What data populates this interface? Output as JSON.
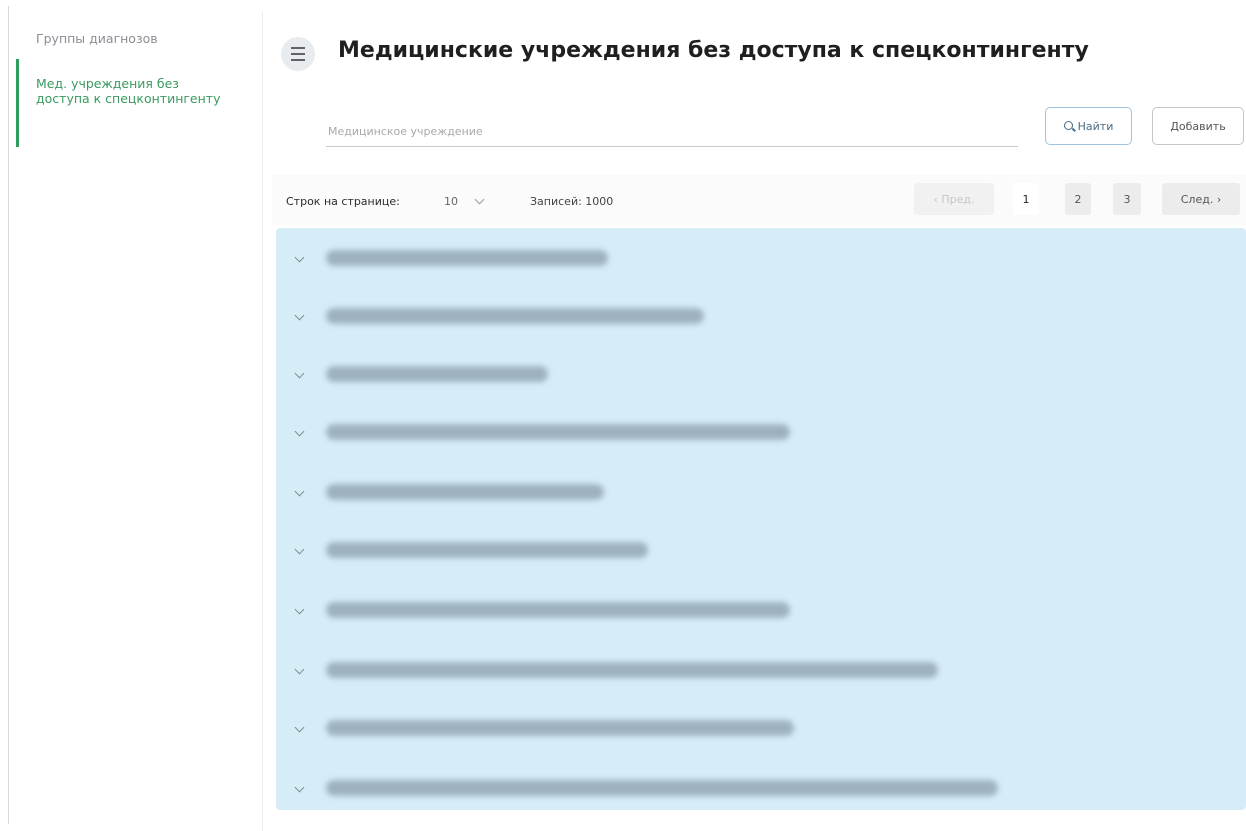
{
  "sidebar": {
    "items": [
      {
        "label": "Группы диагнозов"
      },
      {
        "label": "Мед. учреждения без доступа к спецконтингенту"
      }
    ]
  },
  "header": {
    "title": "Медицинские учреждения без доступа к спецконтингенту",
    "menu_icon": "hamburger-icon"
  },
  "search": {
    "placeholder": "Медицинское учреждение",
    "value": "",
    "find_label": "Найти",
    "add_label": "Добавить"
  },
  "pagination": {
    "rows_per_page_label": "Строк на странице:",
    "rows_per_page_value": "10",
    "records_label": "Записей: 1000",
    "prev_label": "‹ Пред.",
    "pages": [
      "1",
      "2",
      "3"
    ],
    "current_page": "1",
    "next_label": "След. ›"
  },
  "results": {
    "rows": [
      {
        "name": "▇▇▇▇▇▇▇▇▇▇▇▇▇▇▇▇▇▇▇▇▇"
      },
      {
        "name": "▇▇▇▇▇▇▇▇▇▇▇▇▇▇▇▇▇▇▇▇▇▇▇▇▇▇▇▇"
      },
      {
        "name": "▇▇▇▇▇▇▇▇▇▇▇▇▇▇▇▇"
      },
      {
        "name": "▇▇▇▇▇▇▇▇▇▇▇▇▇▇▇▇▇▇▇▇▇▇▇▇▇▇▇▇▇▇▇▇▇▇"
      },
      {
        "name": "▇▇▇▇▇▇▇▇▇▇▇▇▇▇▇▇▇▇▇▇"
      },
      {
        "name": "▇▇▇▇▇▇▇▇▇▇▇▇▇▇▇▇▇▇▇▇▇▇▇▇"
      },
      {
        "name": "▇▇▇▇▇▇▇▇▇▇▇▇▇▇▇▇▇▇▇▇▇▇▇▇▇▇▇▇▇▇▇▇▇▇"
      },
      {
        "name": "▇▇▇▇▇▇▇▇▇▇▇▇▇▇▇▇▇▇▇▇▇▇▇▇▇▇▇▇▇▇▇▇▇▇▇▇▇▇▇▇▇▇▇▇▇"
      },
      {
        "name": "▇▇▇▇▇▇▇▇▇▇▇▇▇▇▇▇▇▇▇▇▇▇▇▇▇▇▇▇▇▇▇▇▇▇"
      },
      {
        "name": "▇▇▇▇▇▇▇▇▇▇▇▇▇▇▇▇▇▇▇▇▇▇▇▇▇▇▇▇▇▇▇▇▇▇▇▇▇▇▇▇▇▇▇▇▇▇▇▇▇▇▇▇▇"
      }
    ]
  },
  "colors": {
    "accent_green": "#2e9d5d",
    "results_background": "#d6edf7",
    "find_button_border": "#9ec4e2"
  }
}
